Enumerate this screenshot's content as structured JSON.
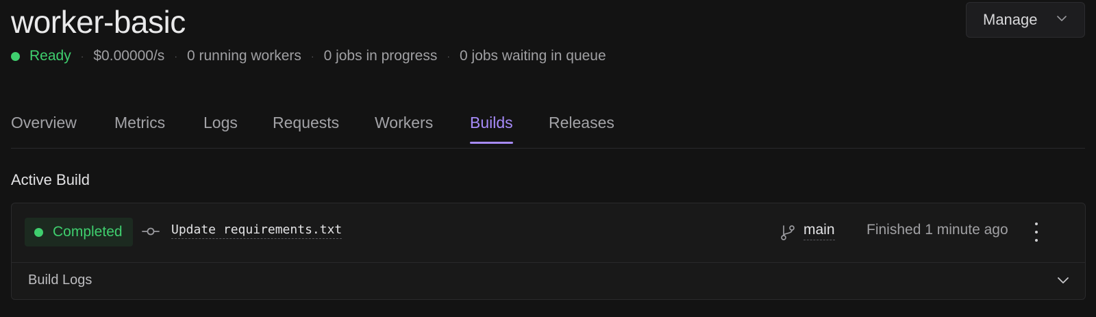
{
  "header": {
    "title": "worker-basic",
    "manage_label": "Manage"
  },
  "status": {
    "state": "Ready",
    "cost": "$0.00000/s",
    "workers": "0 running workers",
    "jobs_in_progress": "0 jobs in progress",
    "jobs_waiting": "0 jobs waiting in queue",
    "separator": "·"
  },
  "tabs": [
    {
      "label": "Overview"
    },
    {
      "label": "Metrics"
    },
    {
      "label": "Logs"
    },
    {
      "label": "Requests"
    },
    {
      "label": "Workers"
    },
    {
      "label": "Builds",
      "active": true
    },
    {
      "label": "Releases"
    }
  ],
  "active_build": {
    "section_title": "Active Build",
    "status": "Completed",
    "commit_message": "Update requirements.txt",
    "branch": "main",
    "finished": "Finished 1 minute ago",
    "logs_label": "Build Logs"
  },
  "colors": {
    "accent": "#a78bfa",
    "success": "#3fcf6e",
    "background": "#131313"
  },
  "icons": {
    "commit": "git-commit-icon",
    "branch": "git-branch-icon",
    "more": "more-vertical-icon",
    "chevron": "chevron-down-icon"
  }
}
